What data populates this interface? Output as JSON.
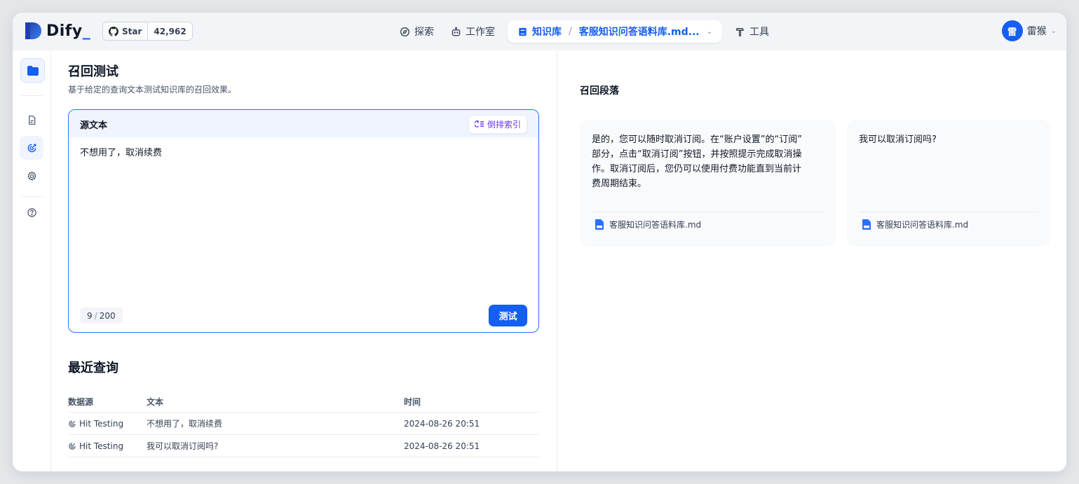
{
  "app": {
    "name": "Dify",
    "github": {
      "star_label": "Star",
      "count": "42,962"
    }
  },
  "nav": {
    "explore": "探索",
    "studio": "工作室",
    "knowledge": "知识库",
    "dataset": "客服知识问答语料库.md...",
    "tools": "工具"
  },
  "user": {
    "avatar_char": "雷",
    "name": "雷猴"
  },
  "colors": {
    "accent": "#155eef",
    "accent_light": "#eff4ff",
    "purple": "#6938ef"
  },
  "main": {
    "title": "召回测试",
    "subtitle": "基于给定的查询文本测试知识库的召回效果。",
    "source": {
      "label": "源文本",
      "inverted_index_label": "倒排索引",
      "text": "不想用了，取消续费",
      "count_current": "9",
      "count_max": "200",
      "test_button": "测试"
    },
    "recent": {
      "title": "最近查询",
      "headers": [
        "数据源",
        "文本",
        "时间"
      ],
      "rows": [
        {
          "source": "Hit Testing",
          "text": "不想用了，取消续费",
          "time": "2024-08-26 20:51"
        },
        {
          "source": "Hit Testing",
          "text": "我可以取消订阅吗?",
          "time": "2024-08-26 20:51"
        }
      ]
    }
  },
  "results": {
    "title": "召回段落",
    "cards": [
      {
        "lines": [
          "是的，您可以随时取消订阅。在“账户设置”的“订阅”",
          "部分，点击“取消订阅”按钮，并按照提示完成取消操",
          "作。取消订阅后，您仍可以使用付费功能直到当前计",
          "费周期结束。"
        ],
        "file": "客服知识问答语料库.md"
      },
      {
        "lines": [
          "我可以取消订阅吗?"
        ],
        "file": "客服知识问答语料库.md"
      }
    ]
  }
}
